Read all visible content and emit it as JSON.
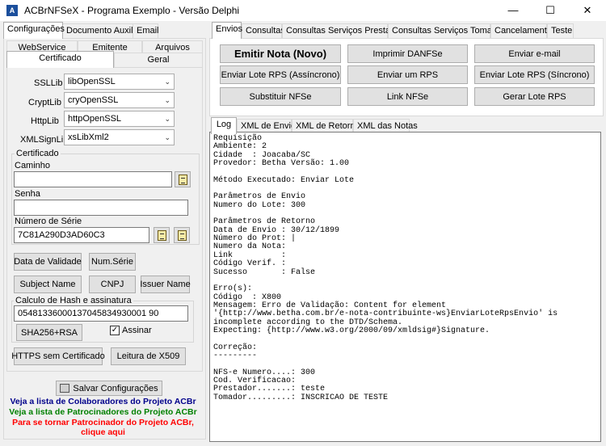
{
  "window": {
    "title": "ACBrNFSeX - Programa Exemplo - Versão Delphi",
    "icon": "app-icon",
    "minimize": "—",
    "maximize": "☐",
    "close": "✕"
  },
  "left_tabs": [
    "Configurações",
    "Documento Auxiliar",
    "Email"
  ],
  "config_tabs_row1": [
    "WebService",
    "Emitente",
    "Arquivos"
  ],
  "config_tabs_row2": [
    "Certificado",
    "Geral"
  ],
  "certificado": {
    "ssllib_label": "SSLLib",
    "ssllib_value": "libOpenSSL",
    "cryptlib_label": "CryptLib",
    "cryptlib_value": "cryOpenSSL",
    "httplib_label": "HttpLib",
    "httplib_value": "httpOpenSSL",
    "xmlsignlib_label": "XMLSignLib",
    "xmlsignlib_value": "xsLibXml2",
    "group_label": "Certificado",
    "caminho_label": "Caminho",
    "caminho_value": "",
    "senha_label": "Senha",
    "senha_value": "",
    "numserie_label": "Número de Série",
    "numserie_value": "7C81A290D3AD60C3",
    "btn_validade": "Data de Validade",
    "btn_numserie": "Num.Série",
    "btn_subject": "Subject Name",
    "btn_cnpj": "CNPJ",
    "btn_issuer": "Issuer Name",
    "hash_group_label": "Calculo de Hash e assinatura",
    "hash_value": "05481336000137045834930001 90",
    "btn_sha": "SHA256+RSA",
    "assinar_label": "Assinar",
    "assinar_checked": true,
    "btn_https": "HTTPS sem Certificado",
    "btn_x509": "Leitura de X509"
  },
  "salvar_label": "Salvar Configurações",
  "links": {
    "colaboradores": "Veja a lista de Colaboradores do Projeto ACBr",
    "patrocinadores": "Veja a lista de Patrocinadores do Projeto ACBr",
    "patrocinar1": "Para se tornar Patrocinador do Projeto ACBr,",
    "patrocinar2": "clique aqui",
    "colors": {
      "colaboradores": "#00008b",
      "patrocinadores": "#008000",
      "patrocinar": "#ff0000"
    }
  },
  "right_tabs": [
    "Envios",
    "Consultas",
    "Consultas Serviços Prestados",
    "Consultas Serviços Tomados",
    "Cancelamento",
    "Teste"
  ],
  "envios_buttons": [
    [
      "Emitir Nota (Novo)",
      "Imprimir DANFSe",
      "Enviar e-mail"
    ],
    [
      "Enviar Lote RPS (Assíncrono)",
      "Enviar um RPS",
      "Enviar Lote RPS (Síncrono)"
    ],
    [
      "Substituir NFSe",
      "Link NFSe",
      "Gerar Lote RPS"
    ]
  ],
  "log_tabs": [
    "Log",
    "XML de Envio",
    "XML de Retorno",
    "XML das Notas"
  ],
  "log_text": "Requisição\nAmbiente: 2\nCidade  : Joacaba/SC\nProvedor: Betha Versão: 1.00\n\nMétodo Executado: Enviar Lote\n\nParâmetros de Envio\nNumero do Lote: 300\n\nParâmetros de Retorno\nData de Envio : 30/12/1899\nNúmero do Prot: |\nNumero da Nota:\nLink          :\nCódigo Verif. :\nSucesso       : False\n\nErro(s):\nCódigo  : X800\nMensagem: Erro de Validação: Content for element\n'{http://www.betha.com.br/e-nota-contribuinte-ws}EnviarLoteRpsEnvio' is\nincomplete according to the DTD/Schema.\nExpecting: {http://www.w3.org/2000/09/xmldsig#}Signature.\n\nCorreção:\n---------\n\nNFS-e Numero....: 300\nCod. Verificacao:\nPrestador.......: teste\nTomador.........: INSCRICAO DE TESTE"
}
